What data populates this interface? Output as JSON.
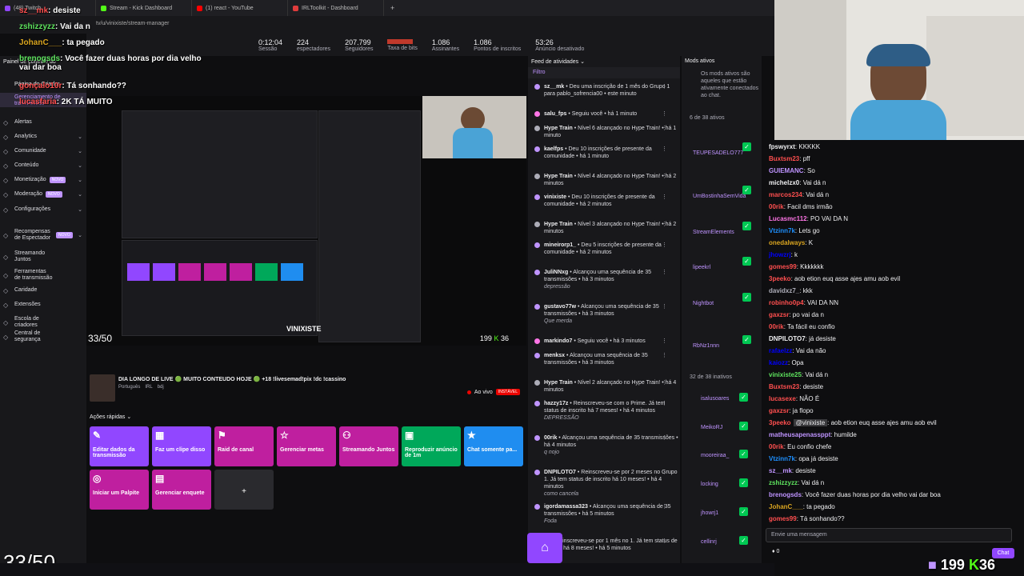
{
  "browser": {
    "tabs": [
      {
        "label": "(48) Twitch",
        "color": "#9146ff"
      },
      {
        "label": "Stream - Kick Dashboard",
        "color": "#53fc18"
      },
      {
        "label": "(1) react - YouTube",
        "color": "#ff0000"
      },
      {
        "label": "IRLToolkit - Dashboard",
        "color": "#e03c3c"
      }
    ],
    "new_tab": "+",
    "address": "tv/u/vinixiste/stream-manager"
  },
  "stats": [
    {
      "value": "0:12:04",
      "label": "Sessão"
    },
    {
      "value": "224",
      "label": "espectadores"
    },
    {
      "value": "207.799",
      "label": "Seguidores"
    },
    {
      "value": "",
      "label": "Taxa de bits"
    },
    {
      "value": "1.086",
      "label": "Assinantes"
    },
    {
      "value": "1.086",
      "label": "Pontos de inscritos"
    },
    {
      "value": "53:26",
      "label": "Anúncio desativado"
    }
  ],
  "sidebar": {
    "top": [
      "Painel de controle do",
      "Página do Criador",
      "Gerenciamento de transmissão"
    ],
    "items": [
      {
        "label": "Alertas",
        "chev": false
      },
      {
        "label": "Analytics",
        "chev": true
      },
      {
        "label": "Comunidade",
        "chev": true
      },
      {
        "label": "Conteúdo",
        "chev": true
      },
      {
        "label": "Monetização",
        "badge": "NOVO",
        "chev": true
      },
      {
        "label": "Moderação",
        "badge": "NOVO",
        "chev": true
      },
      {
        "label": "Configurações",
        "chev": true
      },
      {
        "label": "Recompensas de Espectador",
        "badge": "NOVO",
        "chev": true
      },
      {
        "label": "Streamando Juntos",
        "chev": false
      },
      {
        "label": "Ferramentas de transmissão",
        "chev": false
      },
      {
        "label": "Caridade",
        "chev": false
      },
      {
        "label": "Extensões",
        "chev": false
      },
      {
        "label": "Escola de criadores",
        "chev": false
      },
      {
        "label": "Central de segurança",
        "chev": false
      }
    ]
  },
  "preview": {
    "counter": "33/50",
    "overlay_logo": "VINIXISTE",
    "points": "199",
    "kick": "36"
  },
  "stream_info": {
    "title": "DIA LONGO DE LIVE 🟢 MUITO CONTEUDO HOJE 🟢 +18 !livesemad!pix !dc !cassino",
    "tags": [
      "Português",
      "IRL",
      "bdj"
    ],
    "status": "Ao vivo",
    "status_badge": "INSTÁVEL"
  },
  "quick_actions": {
    "header": "Ações rápidas",
    "items": [
      {
        "label": "Editar dados da transmissão",
        "icon": "✎",
        "color": "#9147ff"
      },
      {
        "label": "Faz um clipe disso",
        "icon": "▦",
        "color": "#9147ff"
      },
      {
        "label": "Raid de canal",
        "icon": "⚑",
        "color": "#bf1f9f"
      },
      {
        "label": "Gerenciar metas",
        "icon": "☆",
        "color": "#bf1f9f"
      },
      {
        "label": "Streamando Juntos",
        "icon": "⚇",
        "color": "#bf1f9f"
      },
      {
        "label": "Reproduzir anúncio de 1m",
        "icon": "▣",
        "color": "#00a85a"
      },
      {
        "label": "Chat somente pa...",
        "icon": "★",
        "color": "#1f8df0"
      },
      {
        "label": "Iniciar um Palpite",
        "icon": "◎",
        "color": "#bf1f9f"
      },
      {
        "label": "Gerenciar enquete",
        "icon": "▤",
        "color": "#bf1f9f"
      },
      {
        "label": "+",
        "icon": "",
        "color": "#2a2a2e"
      }
    ]
  },
  "feed": {
    "header": "Feed de atividades",
    "filter": "Filtro",
    "items": [
      {
        "user": "sz__mk",
        "text": "Deu uma inscrição de 1 mês do Grupo 1 para pablo_sofrencia00 • este minuto",
        "color": "#bf94ff",
        "note": ""
      },
      {
        "user": "salu_fps",
        "text": "Seguiu você • há 1 minuto",
        "color": "#ff75e6",
        "note": ""
      },
      {
        "user": "Hype Train",
        "text": "Nível 6 alcançado no Hype Train! • há 1 minuto",
        "color": "#adadb8",
        "note": ""
      },
      {
        "user": "kaelfps",
        "text": "Deu 10 inscrições de presente da comunidade • há 1 minuto",
        "color": "#bf94ff",
        "note": ""
      },
      {
        "user": "Hype Train",
        "text": "Nível 4 alcançado no Hype Train! • há 2 minutos",
        "color": "#adadb8",
        "note": ""
      },
      {
        "user": "vinixiste",
        "text": "Deu 10 inscrições de presente da comunidade • há 2 minutos",
        "color": "#bf94ff",
        "note": ""
      },
      {
        "user": "Hype Train",
        "text": "Nível 3 alcançado no Hype Train! • há 2 minutos",
        "color": "#adadb8",
        "note": ""
      },
      {
        "user": "mineirorp1_",
        "text": "Deu 5 inscrições de presente da comunidade • há 2 minutos",
        "color": "#bf94ff",
        "note": ""
      },
      {
        "user": "JuliNNxg",
        "text": "Alcançou uma sequência de 35 transmissões • há 3 minutos",
        "color": "#bf94ff",
        "note": "depressão"
      },
      {
        "user": "gustavo77w",
        "text": "Alcançou uma sequência de 35 transmissões • há 3 minutos",
        "color": "#bf94ff",
        "note": "Que merda"
      },
      {
        "user": "markindo7",
        "text": "Seguiu você • há 3 minutos",
        "color": "#ff75e6",
        "note": ""
      },
      {
        "user": "menksx",
        "text": "Alcançou uma sequência de 35 transmissões • há 3 minutos",
        "color": "#bf94ff",
        "note": ""
      },
      {
        "user": "Hype Train",
        "text": "Nível 2 alcançado no Hype Train! • há 4 minutos",
        "color": "#adadb8",
        "note": ""
      },
      {
        "user": "hazzy17z",
        "text": "Reinscreveu-se com o Prime. Já tem status de inscrito há 7 meses! • há 4 minutos",
        "color": "#bf94ff",
        "note": "DEPRESSÃO"
      },
      {
        "user": "00rik",
        "text": "Alcançou uma sequência de 35 transmissões • há 4 minutos",
        "color": "#bf94ff",
        "note": "q nojo"
      },
      {
        "user": "DNPILOTO7",
        "text": "Reinscreveu-se por 2 meses no Grupo 1. Já tem status de inscrito há 10 meses! • há 4 minutos",
        "color": "#bf94ff",
        "note": "como cancela"
      },
      {
        "user": "igordamassa323",
        "text": "Alcançou uma sequência de 35 transmissões • há 5 minutos",
        "color": "#bf94ff",
        "note": "Foda"
      },
      {
        "user": "15",
        "text": "Reinscreveu-se por 1 mês no 1. Já tem status de inscrito há 8 meses! • há 5 minutos",
        "color": "#bf94ff",
        "note": ""
      }
    ]
  },
  "mods": {
    "header": "Mods ativos",
    "desc": "Os mods ativos são aqueles que estão ativamente conectados ao chat.",
    "active_count": "6 de 38 ativos",
    "inactive_count": "32 de 38 inativos",
    "active": [
      "TEUPESADELO777",
      "UmBostinhaSemVida",
      "StreamElements",
      "lipeekrl",
      "Nightbot",
      "RbNz1nnn"
    ],
    "inactive": [
      "isalusoares",
      "MeikoRJ",
      "mooreiraa_",
      "locking",
      "jhowrj1",
      "cellinrj"
    ]
  },
  "chat": {
    "lines": [
      {
        "user": "fpswyrxt",
        "msg": "KKKKK",
        "color": "#efeff1"
      },
      {
        "user": "Buxtsm23",
        "msg": "pff",
        "color": "#ff4f4f"
      },
      {
        "user": "GUIEMANC",
        "msg": "So",
        "color": "#bf94ff"
      },
      {
        "user": "michelzx0",
        "msg": "Vai dá n",
        "color": "#efeff1"
      },
      {
        "user": "marcos234",
        "msg": "Vai dá n",
        "color": "#ff4f4f"
      },
      {
        "user": "00rik",
        "msg": "Facil dms irmão",
        "color": "#ff4f4f"
      },
      {
        "user": "Lucasmc112",
        "msg": "PO VAI DA N",
        "color": "#ff75e6"
      },
      {
        "user": "Vtzinn7k",
        "msg": "Lets go",
        "color": "#1e90ff"
      },
      {
        "user": "onedalways",
        "msg": "K",
        "color": "#daa520"
      },
      {
        "user": "jhowzrj",
        "msg": "k",
        "color": "#0000ff"
      },
      {
        "user": "gomes99",
        "msg": "Kkkkkkk",
        "color": "#ff4f4f"
      },
      {
        "user": "3peeko",
        "msg": "aob etion euq asse ajes amu aob evil",
        "color": "#ff4f4f"
      },
      {
        "user": "davidxz7_",
        "msg": "kkk",
        "color": "#adadb8"
      },
      {
        "user": "robinho0p4",
        "msg": "VAI DA NN",
        "color": "#ff4f4f"
      },
      {
        "user": "gaxzsr",
        "msg": "po vai da n",
        "color": "#ff4f4f"
      },
      {
        "user": "00rik",
        "msg": "Ta fácil eu confio",
        "color": "#ff4f4f"
      },
      {
        "user": "DNPILOTO7",
        "msg": "já desiste",
        "color": "#efeff1"
      },
      {
        "user": "rafaelzz",
        "msg": "Vai da não",
        "color": "#0000ff"
      },
      {
        "user": "kaiozz",
        "msg": "Opa",
        "color": "#0000ff"
      },
      {
        "user": "vinixiste25",
        "msg": "Vai dá n",
        "color": "#5ee35e"
      },
      {
        "user": "Buxtsm23",
        "msg": "desiste",
        "color": "#ff4f4f"
      },
      {
        "user": "lucasexe",
        "msg": "NÃO É",
        "color": "#ff4f4f"
      },
      {
        "user": "gaxzsr",
        "msg": "ja flopo",
        "color": "#ff4f4f"
      },
      {
        "user": "3peeko",
        "msg": "aob etion euq asse ajes amu aob evil",
        "color": "#ff4f4f"
      },
      {
        "user": "matheusapenassppt",
        "msg": "humilde",
        "color": "#bf94ff"
      },
      {
        "user": "00rik",
        "msg": "Eu confio chefe",
        "color": "#ff4f4f"
      },
      {
        "user": "Vtzinn7k",
        "msg": "opa já desiste",
        "color": "#1e90ff"
      },
      {
        "user": "sz__mk",
        "msg": "desiste",
        "color": "#bf94ff"
      },
      {
        "user": "zshizzyzz",
        "msg": "Vai dá n",
        "color": "#5ee35e"
      },
      {
        "user": "brenogsds",
        "msg": "Você fazer duas horas por dia velho vai dar boa",
        "color": "#bf94ff"
      },
      {
        "user": "JohanC___",
        "msg": "ta pegado",
        "color": "#daa520"
      },
      {
        "user": "gomes99",
        "msg": "Tá sonhando??",
        "color": "#ff4f4f"
      }
    ],
    "mention_tag": "@vinixiste",
    "input_placeholder": "Envie uma mensagem",
    "points": "0",
    "send_label": "Chat"
  },
  "overlay_chat": [
    {
      "user": "sz__mk",
      "msg": "desiste",
      "color": "#ff4f4f"
    },
    {
      "user": "zshizzyzz",
      "msg": "Vai da n",
      "color": "#5ee35e"
    },
    {
      "user": "JohanC___",
      "msg": "ta pegado",
      "color": "#daa520"
    },
    {
      "user": "brenogsds",
      "msg": "Você fazer duas horas por dia velho vai dar boa",
      "color": "#5ee35e"
    },
    {
      "user": "gonçalo10r",
      "msg": "Tá sonhando??",
      "color": "#ff4f4f"
    },
    {
      "user": "lucasfaria",
      "msg": "2K TÁ MUITO",
      "color": "#ff4f4f"
    }
  ],
  "bottom_counter": "33/50",
  "bottom_points": "199",
  "bottom_kick": "36"
}
